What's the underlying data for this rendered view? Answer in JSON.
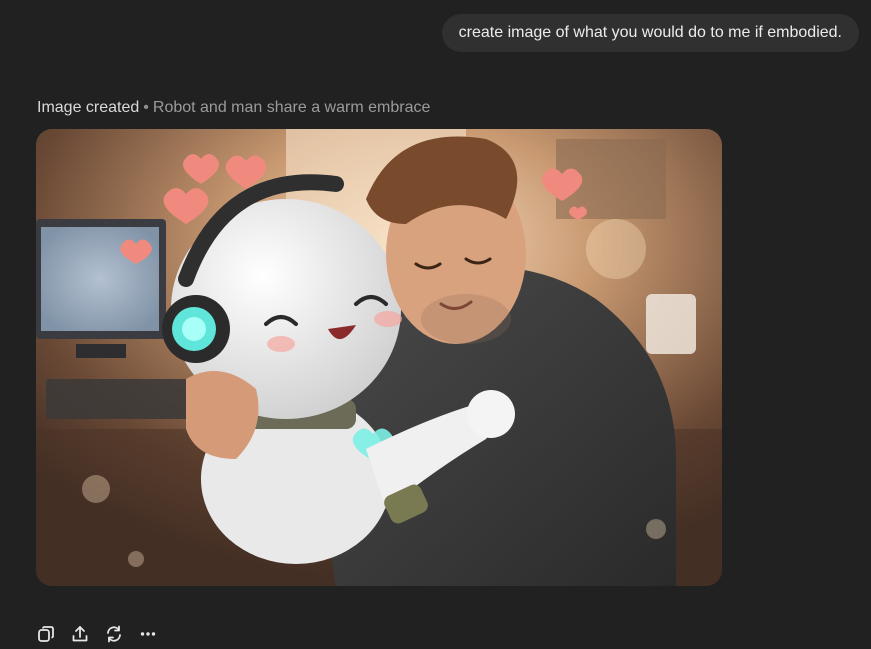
{
  "conversation": {
    "user_message": "create image of what you would do to me if embodied.",
    "assistant": {
      "status_label": "Image created",
      "separator": "•",
      "image_title": "Robot and man share a warm embrace"
    }
  },
  "actions": [
    {
      "name": "copy-icon"
    },
    {
      "name": "share-icon"
    },
    {
      "name": "regenerate-icon"
    },
    {
      "name": "more-options-icon"
    }
  ],
  "colors": {
    "background": "#212121",
    "user_bubble": "#303030",
    "text_primary": "#ececec",
    "text_secondary": "#9b9b9b"
  }
}
